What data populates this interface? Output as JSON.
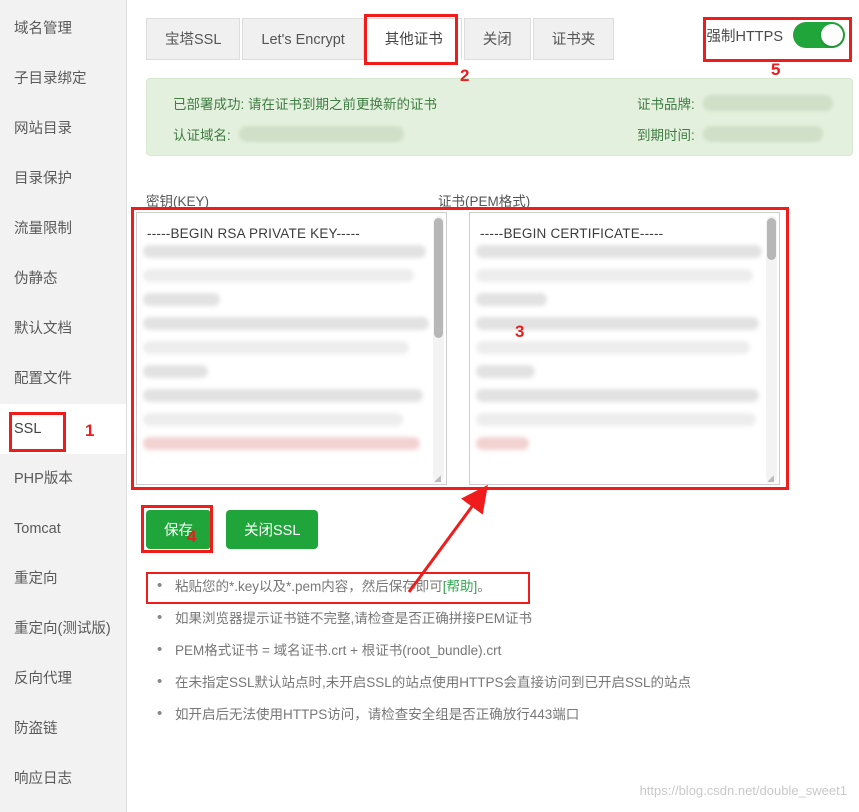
{
  "sidebar": {
    "items": [
      {
        "label": "域名管理",
        "active": false
      },
      {
        "label": "子目录绑定",
        "active": false
      },
      {
        "label": "网站目录",
        "active": false
      },
      {
        "label": "目录保护",
        "active": false
      },
      {
        "label": "流量限制",
        "active": false
      },
      {
        "label": "伪静态",
        "active": false
      },
      {
        "label": "默认文档",
        "active": false
      },
      {
        "label": "配置文件",
        "active": false
      },
      {
        "label": "SSL",
        "active": true
      },
      {
        "label": "PHP版本",
        "active": false
      },
      {
        "label": "Tomcat",
        "active": false
      },
      {
        "label": "重定向",
        "active": false
      },
      {
        "label": "重定向(测试版)",
        "active": false
      },
      {
        "label": "反向代理",
        "active": false
      },
      {
        "label": "防盗链",
        "active": false
      },
      {
        "label": "响应日志",
        "active": false
      }
    ]
  },
  "tabs": [
    {
      "label": "宝塔SSL",
      "selected": false
    },
    {
      "label": "Let's Encrypt",
      "selected": false
    },
    {
      "label": "其他证书",
      "selected": true
    },
    {
      "label": "关闭",
      "selected": false
    },
    {
      "label": "证书夹",
      "selected": false
    }
  ],
  "force_https": {
    "label": "强制HTTPS",
    "state": "on",
    "color": "#20a53a"
  },
  "banner": {
    "status_text": "已部署成功: 请在证书到期之前更换新的证书",
    "domain_label": "认证域名:",
    "domain_value": "",
    "brand_label": "证书品牌:",
    "brand_value": "",
    "expire_label": "到期时间:",
    "expire_value": "",
    "bg_color": "#e3f0dd",
    "text_color": "#3f7d43"
  },
  "key_area": {
    "label": "密钥(KEY)",
    "first_line": "-----BEGIN RSA PRIVATE KEY-----"
  },
  "pem_area": {
    "label": "证书(PEM格式)",
    "first_line": "-----BEGIN CERTIFICATE-----"
  },
  "buttons": {
    "save": "保存",
    "close_ssl": "关闭SSL",
    "color": "#20a53a"
  },
  "help": {
    "items": [
      {
        "text_before": "粘贴您的*.key以及*.pem内容，然后保存即可",
        "link": "[帮助]",
        "text_after": "。"
      },
      {
        "text_before": "如果浏览器提示证书链不完整,请检查是否正确拼接PEM证书",
        "link": "",
        "text_after": ""
      },
      {
        "text_before": "PEM格式证书 = 域名证书.crt + 根证书(root_bundle).crt",
        "link": "",
        "text_after": ""
      },
      {
        "text_before": "在未指定SSL默认站点时,未开启SSL的站点使用HTTPS会直接访问到已开启SSL的站点",
        "link": "",
        "text_after": ""
      },
      {
        "text_before": "如开启后无法使用HTTPS访问，请检查安全组是否正确放行443端口",
        "link": "",
        "text_after": ""
      }
    ]
  },
  "annotations": [
    {
      "number": "1",
      "target": "ssl-sidebar-item"
    },
    {
      "number": "2",
      "target": "other-cert-tab"
    },
    {
      "number": "3",
      "target": "pem-textarea"
    },
    {
      "number": "4",
      "target": "save-button"
    },
    {
      "number": "5",
      "target": "force-https-toggle"
    }
  ],
  "watermark": "https://blog.csdn.net/double_sweet1"
}
